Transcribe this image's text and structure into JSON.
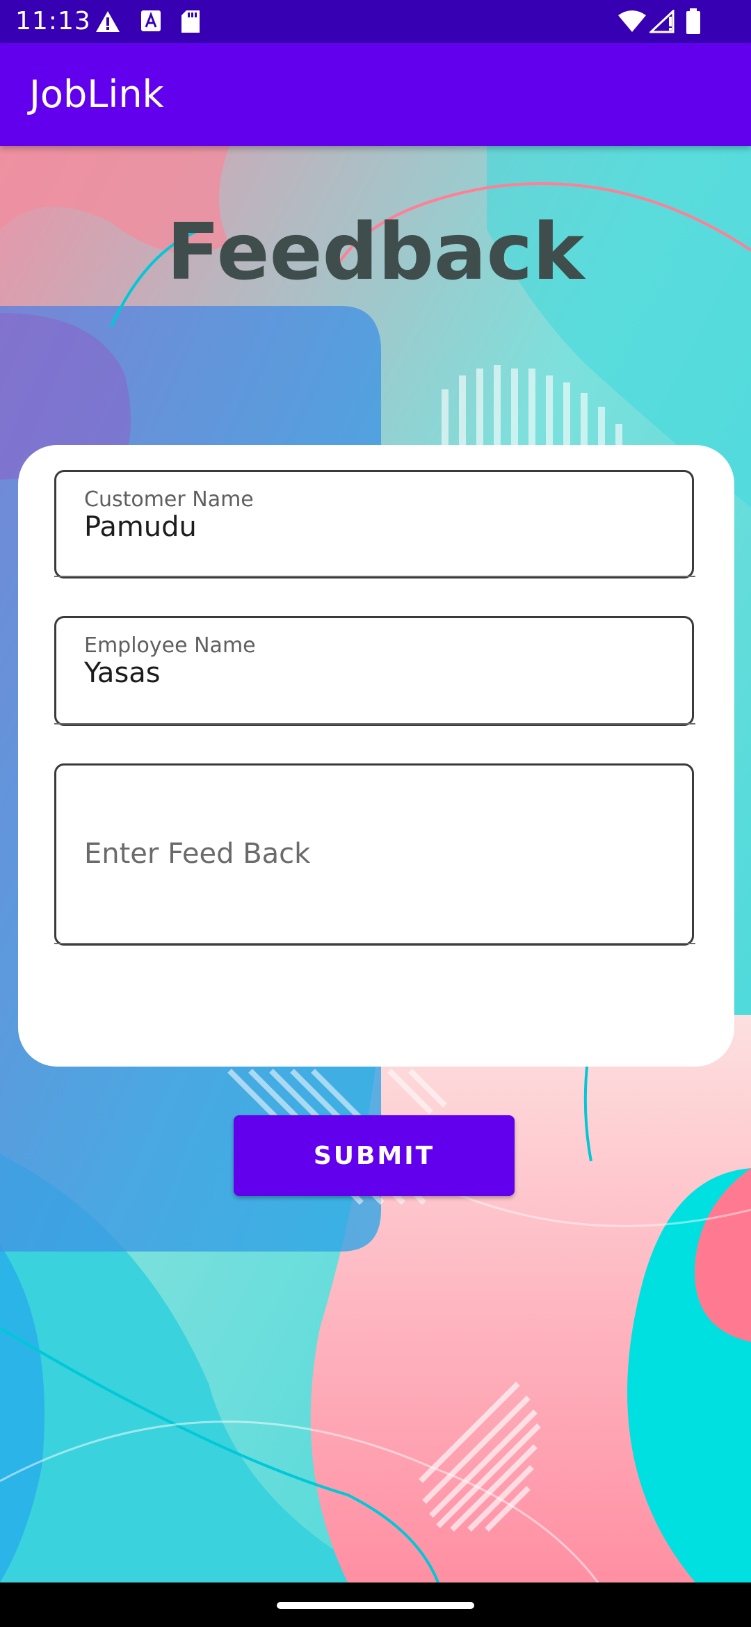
{
  "status_bar": {
    "time": "11:13",
    "icons": [
      "warning-icon",
      "a-font-icon",
      "sd-card-icon",
      "wifi-icon",
      "signal-icon",
      "battery-icon"
    ]
  },
  "app_bar": {
    "title": "JobLink"
  },
  "page": {
    "title": "Feedback"
  },
  "form": {
    "customer": {
      "label": "Customer Name",
      "value": "Pamudu"
    },
    "employee": {
      "label": "Employee Name",
      "value": "Yasas"
    },
    "feedback": {
      "placeholder": "Enter Feed Back"
    },
    "submit_label": "SUBMIT"
  },
  "colors": {
    "primary": "#6200ee",
    "primary_dark": "#3700b3",
    "title_text": "#3f4d4c"
  }
}
